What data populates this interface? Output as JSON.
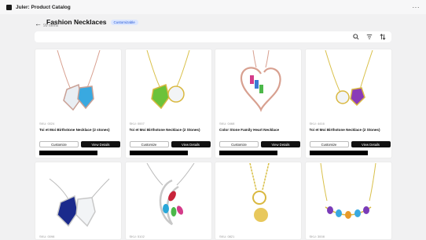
{
  "app": {
    "title": "Juler: Product Catalog",
    "more": "···"
  },
  "header": {
    "back": "←",
    "title": "Fashion Necklaces",
    "badge": "Customizable",
    "count": "99 Items"
  },
  "toolbar": {
    "icons": [
      "search-icon",
      "filter-icon",
      "sort-icon"
    ]
  },
  "buttons": {
    "customize": "Customize",
    "details": "View Details"
  },
  "products": [
    {
      "sku": "SKU: 0024",
      "name": "Toi et Moi Birthstone Necklace (2 stones)"
    },
    {
      "sku": "SKU: 0007",
      "name": "Toi et Moi Birthstone Necklace (2 Stones)"
    },
    {
      "sku": "SKU: 0468",
      "name": "Color Stone Family Heart Necklace"
    },
    {
      "sku": "SKU: 4416",
      "name": "Toi et Moi Birthstone Necklace (2 Stones)"
    },
    {
      "sku": "SKU: 0098"
    },
    {
      "sku": "SKU: 5102"
    },
    {
      "sku": "SKU: 0821"
    },
    {
      "sku": "SKU: 3008"
    }
  ]
}
